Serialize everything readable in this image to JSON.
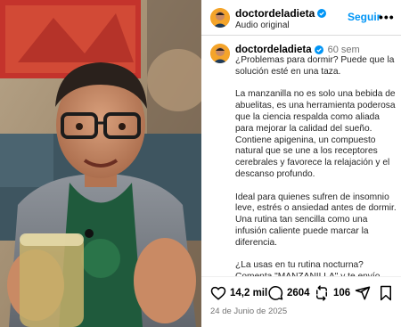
{
  "post": {
    "username": "doctordeladieta",
    "audio": "Audio original",
    "follow_label": "Seguir",
    "more_label": "•••",
    "time_ago": "60 sem",
    "date": "24 de Junio de 2025"
  },
  "caption": {
    "lines": [
      "¿Problemas para dormir? Puede que la solución esté en una taza.",
      "La manzanilla no es solo una bebida de abuelitas, es una herramienta poderosa que la ciencia respalda como aliada para mejorar la calidad del sueño.",
      "Contiene apigenina, un compuesto natural que se une a los receptores cerebrales y favorece la relajación y el descanso profundo.",
      "Ideal para quienes sufren de insomnio leve, estrés o ansiedad antes de dormir. Una rutina tan sencilla como una infusión caliente puede marcar la diferencia.",
      "¿La usas en tu rutina nocturna? Comenta \"MANZANILLA\" y te envío una sorpresa"
    ]
  },
  "stats": {
    "likes": "14,2 mil",
    "comments": "2604",
    "reposts": "106"
  },
  "icons": {
    "verified": "verified-badge-icon",
    "like": "heart-icon",
    "comment": "comment-bubble-icon",
    "repost": "repost-icon",
    "share": "paper-plane-icon",
    "save": "bookmark-icon"
  },
  "colors": {
    "accent": "#0095f6",
    "verified": "#0095f6",
    "avatar_bg": "#f4a42a",
    "muted": "#737373"
  }
}
